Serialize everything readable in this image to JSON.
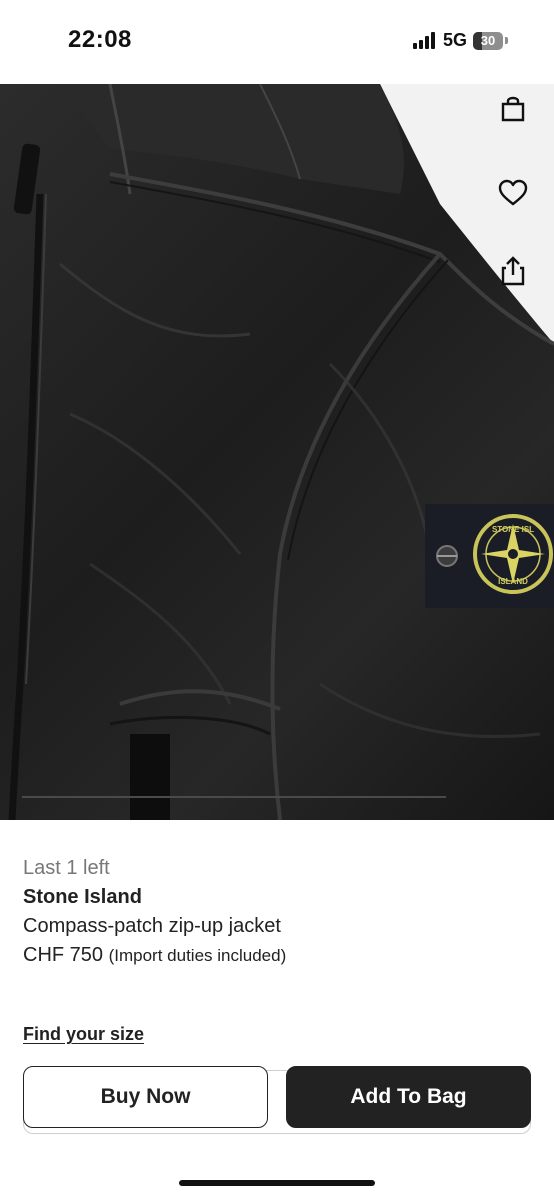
{
  "status_bar": {
    "time": "22:08",
    "network": "5G",
    "battery_percent": "30",
    "battery_level": 0.3
  },
  "product_image": {
    "alt": "Stone Island compass-patch zip-up jacket close-up",
    "actions": {
      "bag_icon": "shopping-bag-icon",
      "wishlist_icon": "heart-icon",
      "share_icon": "share-icon"
    },
    "patch_text_top": "STONE ISL",
    "patch_text_bottom": "ISLAND"
  },
  "product": {
    "stock_note": "Last 1 left",
    "brand": "Stone Island",
    "name": "Compass-patch zip-up jacket",
    "price": "CHF 750",
    "price_note": "(Import duties included)"
  },
  "find_size_label": "Find your size",
  "buttons": {
    "buy_now": "Buy Now",
    "add_to_bag": "Add To Bag"
  },
  "colors": {
    "primary": "#222222",
    "muted_text": "#777777",
    "background": "#ffffff"
  }
}
